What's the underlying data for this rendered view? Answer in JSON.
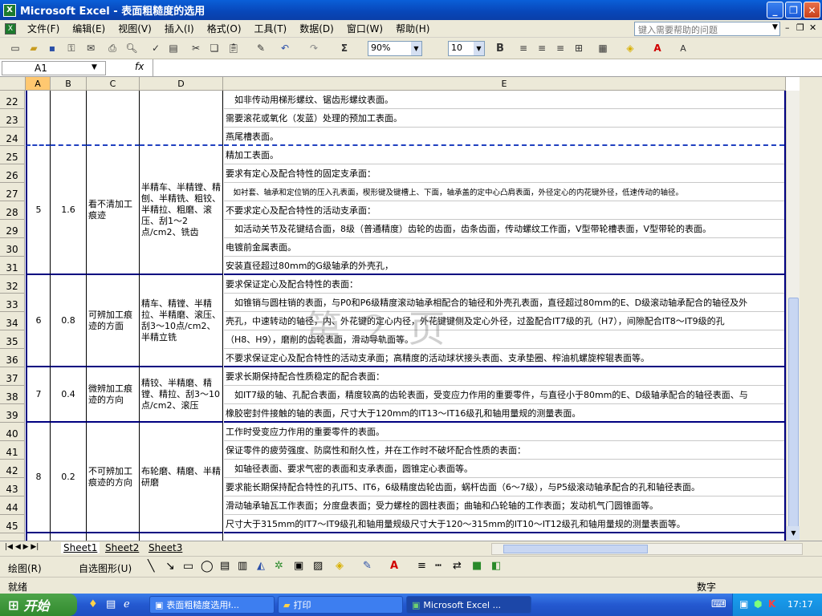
{
  "window": {
    "title": "Microsoft Excel - 表面粗糙度的选用"
  },
  "menu": [
    "文件(F)",
    "编辑(E)",
    "视图(V)",
    "插入(I)",
    "格式(O)",
    "工具(T)",
    "数据(D)",
    "窗口(W)",
    "帮助(H)"
  ],
  "help_placeholder": "键入需要帮助的问题",
  "toolbar": {
    "zoom": "90%",
    "font_size": "10",
    "bold": "B",
    "sigma": "Σ"
  },
  "formula": {
    "name_box": "A1",
    "fx": "fx"
  },
  "columns": [
    "A",
    "B",
    "C",
    "D",
    "E"
  ],
  "rows": [
    "22",
    "23",
    "24",
    "25",
    "26",
    "27",
    "28",
    "29",
    "30",
    "31",
    "32",
    "33",
    "34",
    "35",
    "36",
    "37",
    "38",
    "39",
    "40",
    "41",
    "42",
    "43",
    "44",
    "45",
    "46"
  ],
  "groups": [
    {
      "a": "5",
      "b": "1.6",
      "c": "看不清加工痕迹",
      "d": "半精车、半精镗、精刨、半精铣、粗铰、半精拉、粗磨、滚压、刮1～2点/cm2、铣齿"
    },
    {
      "a": "6",
      "b": "0.8",
      "c": "可辨加工痕迹的方面",
      "d": "精车、精镗、半精拉、半精磨、滚压、刮3～10点/cm2、半精立铣"
    },
    {
      "a": "7",
      "b": "0.4",
      "c": "微辨加工痕迹的方向",
      "d": "精铰、半精磨、精镗、精拉、刮3～10点/cm2、滚压"
    },
    {
      "a": "8",
      "b": "0.2",
      "c": "不可辨加工痕迹的方向",
      "d": "布轮磨、精磨、半精研磨"
    }
  ],
  "e_lines": [
    "　如非传动用梯形螺纹、锯齿形螺纹表面。",
    "需要滚花或氧化（发蓝）处理的预加工表面。",
    "燕尾槽表面。",
    "精加工表面。",
    "要求有定心及配合特性的固定支承面：",
    "　如衬套、轴承和定位销的压入孔表面，楔形键及键槽上、下面，轴承盖的定中心凸肩表面，外径定心的内花键外径，低速传动的轴径。",
    "不要求定心及配合特性的活动支承面：",
    "　如活动关节及花键结合面，8级（普通精度）齿轮的齿面，齿条齿面，传动螺纹工作面，V型带轮槽表面，V型带轮的表面。",
    "电镀前金属表面。",
    "安装直径超过80mm的G级轴承的外壳孔，",
    "要求保证定心及配合特性的表面：",
    "　如锥销与圆柱销的表面，与P0和P6级精度滚动轴承相配合的轴径和外壳孔表面，直径超过80mm的E、D级滚动轴承配合的轴径及外",
    "壳孔，中速转动的轴径，内、外花键的定心内径，外花键键侧及定心外径，过盈配合IT7级的孔（H7），间隙配合IT8～IT9级的孔",
    "（H8、H9），磨削的齿轮表面，滑动导轨面等。",
    "不要求保证定心及配合特性的活动支承面；高精度的活动球状接头表面、支承垫圈、榨油机螺旋榨辊表面等。",
    "要求长期保持配合性质稳定的配合表面：",
    "　如IT7级的轴、孔配合表面，精度较高的齿轮表面，受变应力作用的重要零件，与直径小于80mm的E、D级轴承配合的轴径表面、与",
    "橡胶密封件接触的轴的表面，尺寸大于120mm的IT13～IT16级孔和轴用量规的测量表面。",
    "工作时受变应力作用的重要零件的表面。",
    "保证零件的疲劳强度、防腐性和耐久性，并在工作时不破坏配合性质的表面：",
    "　如轴径表面、要求气密的表面和支承表面，圆锥定心表面等。",
    "要求能长期保持配合特性的孔IT5、IT6，6级精度齿轮齿面，蜗杆齿面（6～7级），与P5级滚动轴承配合的孔和轴径表面。",
    "滑动轴承轴瓦工作表面；分度盘表面；受力螺栓的圆柱表面；曲轴和凸轮轴的工作表面；发动机气门圆锥面等。",
    "尺寸大于315mm的IT7～IT9级孔和轴用量规级尺寸大于120～315mm的IT10～IT12级孔和轴用量规的测量表面等。",
    ""
  ],
  "watermark": "第 2 页",
  "sheets": [
    "Sheet1",
    "Sheet2",
    "Sheet3"
  ],
  "drawbar": {
    "draw": "绘图(R)",
    "autoshape": "自选图形(U)"
  },
  "status": {
    "left": "就绪",
    "right": "数字"
  },
  "taskbar": {
    "start": "开始",
    "tasks": [
      "表面粗糙度选用ł...",
      "打印",
      "Microsoft Excel ..."
    ],
    "clock": "17:17"
  }
}
